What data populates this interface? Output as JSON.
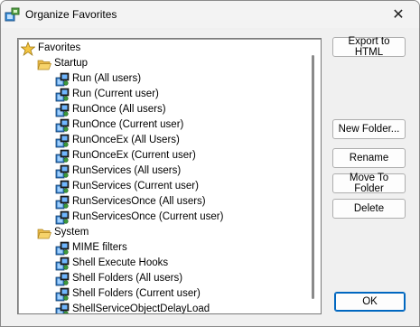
{
  "window": {
    "title": "Organize Favorites",
    "close_glyph": "✕"
  },
  "tree": {
    "root": {
      "label": "Favorites",
      "icon": "star-icon"
    },
    "groups": [
      {
        "label": "Startup",
        "icon": "folder-open-icon",
        "items": [
          "Run (All users)",
          "Run (Current user)",
          "RunOnce (All users)",
          "RunOnce (Current user)",
          "RunOnceEx (All Users)",
          "RunOnceEx (Current user)",
          "RunServices (All users)",
          "RunServices (Current user)",
          "RunServicesOnce (All users)",
          "RunServicesOnce (Current user)"
        ]
      },
      {
        "label": "System",
        "icon": "folder-open-icon",
        "items": [
          "MIME filters",
          "Shell Execute Hooks",
          "Shell Folders (All users)",
          "Shell Folders (Current user)",
          "ShellServiceObjectDelayLoad"
        ]
      }
    ],
    "item_icon": "registry-key-icon"
  },
  "buttons": {
    "export": "Export to HTML",
    "new_folder": "New Folder...",
    "rename": "Rename",
    "move_to_folder": "Move To Folder",
    "delete": "Delete",
    "ok": "OK"
  },
  "colors": {
    "folder": "#f6d36b",
    "star": "#f4c542",
    "ok_border": "#0067c0"
  }
}
